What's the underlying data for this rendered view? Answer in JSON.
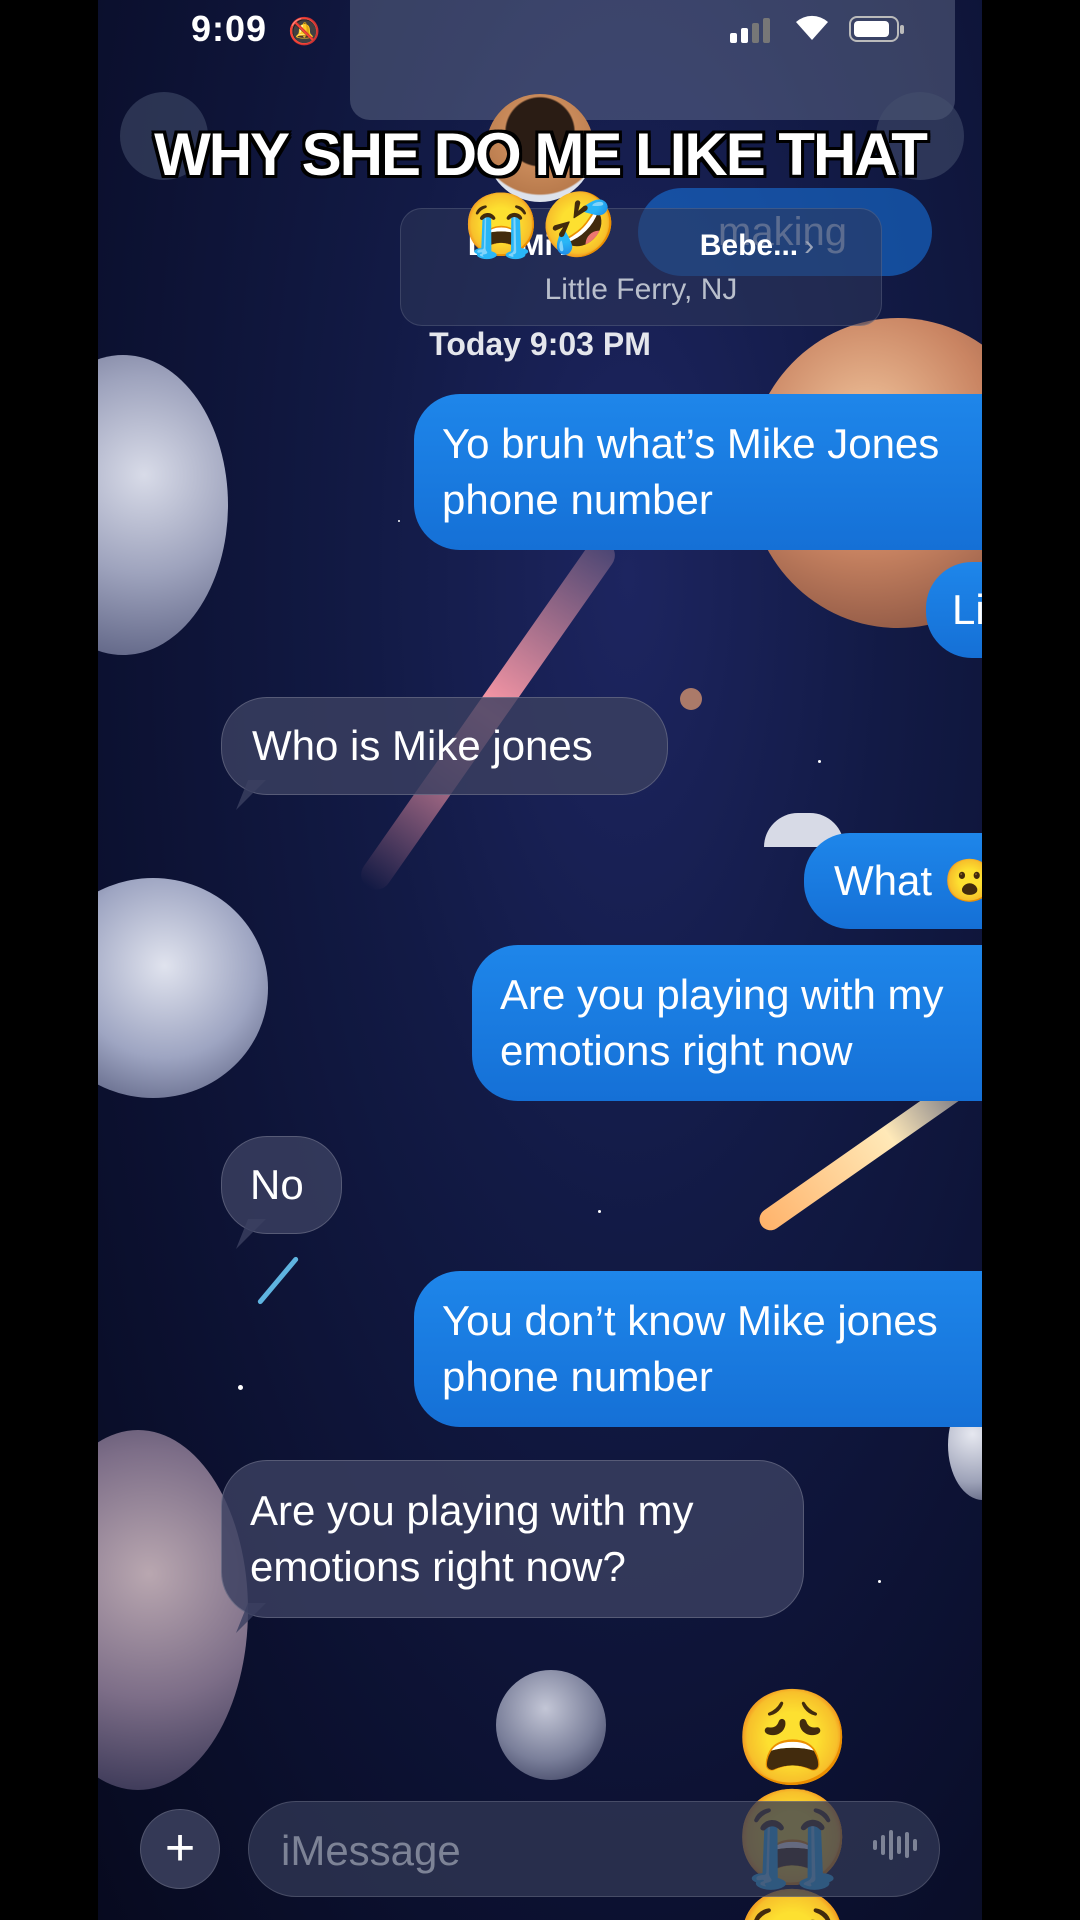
{
  "status_bar": {
    "time": "9:09",
    "mute_icon": "bell-slash-icon",
    "signal_icon": "cellular-signal-icon",
    "wifi_icon": "wifi-icon",
    "battery_icon": "battery-icon"
  },
  "overlay_caption": {
    "line1": "WHY SHE DO ME LIKE THAT",
    "line2": "😭🤣"
  },
  "header": {
    "contact_name": "Lili Mi A",
    "contact_name_suffix": "Bebe...",
    "chevron": "›",
    "location": "Little Ferry, NJ",
    "background_bubble_text": "making",
    "timestamp": "Today 9:03 PM"
  },
  "messages": [
    {
      "from": "me",
      "text": "Yo bruh what’s Mike Jones phone number"
    },
    {
      "from": "me",
      "text": "Lili"
    },
    {
      "from": "them",
      "text": "Who is Mike jones"
    },
    {
      "from": "me",
      "text": "What 😮"
    },
    {
      "from": "me",
      "text": "Are you playing with my emotions right now"
    },
    {
      "from": "them",
      "text": "No"
    },
    {
      "from": "me",
      "text": "You don’t know Mike jones phone number"
    },
    {
      "from": "them",
      "text": "Are you playing with my emotions right now?"
    },
    {
      "from": "me",
      "text": "😩 😭 😭"
    }
  ],
  "composer": {
    "add_label": "+",
    "placeholder": "iMessage",
    "audio_icon": "waveform-icon"
  },
  "colors": {
    "outgoing_bubble": "#1878E0",
    "incoming_bubble": "#3A4060",
    "background": "#0E1438"
  }
}
